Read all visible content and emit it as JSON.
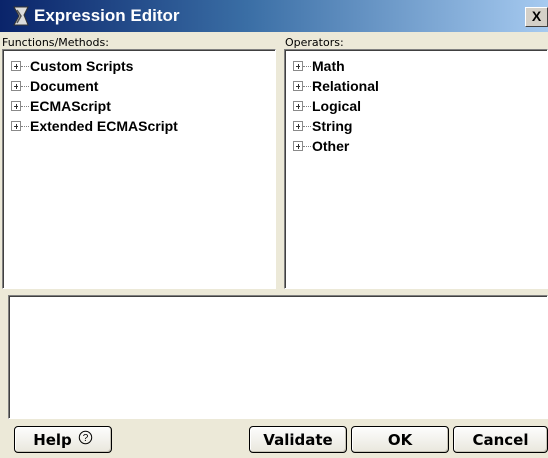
{
  "window": {
    "title": "Expression Editor",
    "close_label": "X"
  },
  "functions": {
    "label": "Functions/Methods:",
    "items": [
      {
        "label": "Custom Scripts"
      },
      {
        "label": "Document"
      },
      {
        "label": "ECMAScript"
      },
      {
        "label": "Extended ECMAScript"
      }
    ]
  },
  "operators": {
    "label": "Operators:",
    "items": [
      {
        "label": "Math"
      },
      {
        "label": "Relational"
      },
      {
        "label": "Logical"
      },
      {
        "label": "String"
      },
      {
        "label": "Other"
      }
    ]
  },
  "expression": {
    "value": ""
  },
  "buttons": {
    "help": "Help",
    "help_icon": "?",
    "validate": "Validate",
    "ok": "OK",
    "cancel": "Cancel"
  },
  "icons": {
    "title": "expression-editor-icon",
    "expander": "plus-box-icon",
    "help": "question-circle-icon"
  }
}
